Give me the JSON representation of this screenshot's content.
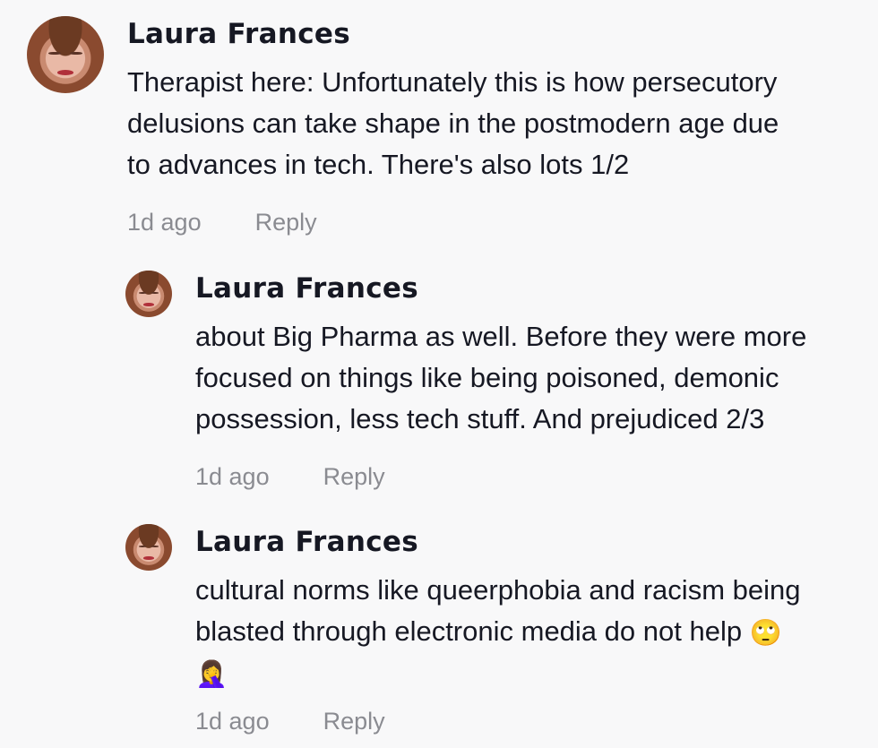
{
  "comments": [
    {
      "username": "Laura Frances",
      "lines": [
        "Therapist here: Unfortunately this is how persecutory",
        "delusions can take shape in the postmodern age due",
        "to advances in tech. There's also lots 1/2"
      ],
      "time": "1d ago",
      "reply_label": "Reply"
    },
    {
      "username": "Laura Frances",
      "lines": [
        "about Big Pharma as well. Before they were more",
        "focused on things like being poisoned, demonic",
        "possession, less tech stuff. And prejudiced 2/3"
      ],
      "time": "1d ago",
      "reply_label": "Reply"
    },
    {
      "username": "Laura Frances",
      "lines": [
        "cultural norms like queerphobia and racism being",
        "blasted through electronic media do not help"
      ],
      "emoji_inline": "🙄",
      "emoji_line": "🤦‍♀️",
      "time": "1d ago",
      "reply_label": "Reply"
    }
  ]
}
